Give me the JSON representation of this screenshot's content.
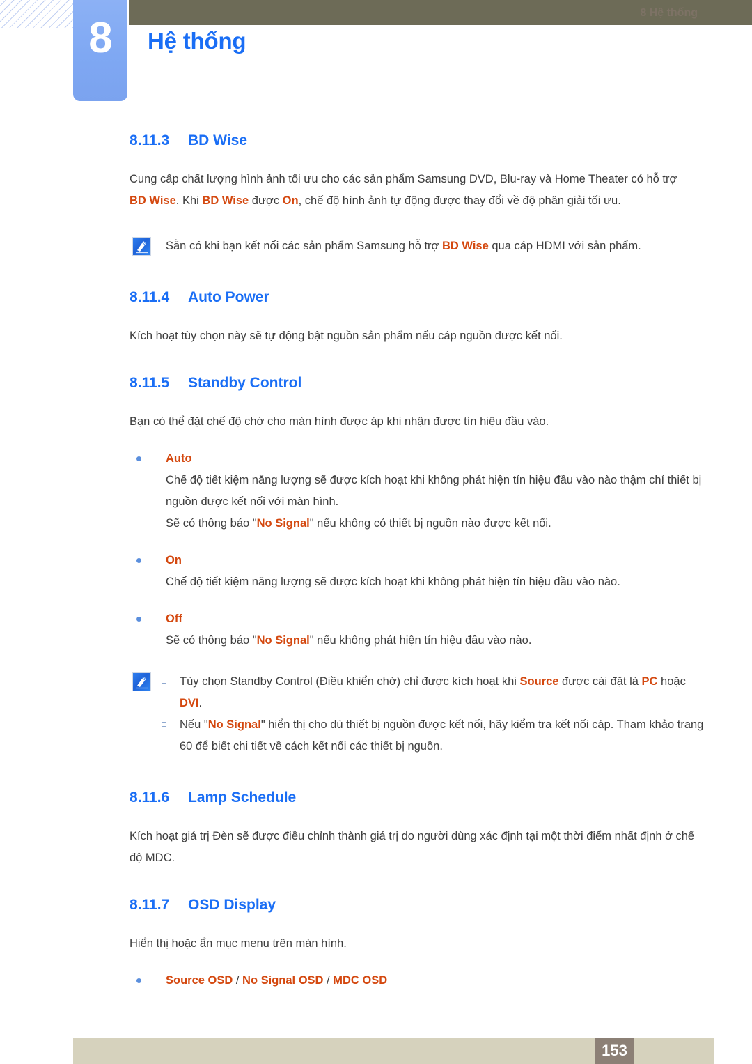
{
  "header": {
    "chapter_number": "8",
    "chapter_title": "Hệ thống"
  },
  "sections": [
    {
      "number": "8.11.3",
      "title": "BD Wise",
      "paragraph_pre": "Cung cấp chất lượng hình ảnh tối ưu cho các sản phẩm Samsung DVD, Blu-ray và Home Theater có hỗ trợ ",
      "kw1": "BD Wise",
      "paragraph_mid1": ". Khi ",
      "kw2": "BD Wise",
      "paragraph_mid2": " được ",
      "kw3": "On",
      "paragraph_end": ", chế độ hình ảnh tự động được thay đổi về độ phân giải tối ưu.",
      "note_pre": "Sẵn có khi bạn kết nối các sản phẩm Samsung hỗ trợ ",
      "note_kw": "BD Wise",
      "note_post": " qua cáp HDMI với sản phẩm."
    },
    {
      "number": "8.11.4",
      "title": "Auto Power",
      "paragraph": "Kích hoạt tùy chọn này sẽ tự động bật nguồn sản phẩm nếu cáp nguồn được kết nối."
    },
    {
      "number": "8.11.5",
      "title": "Standby Control",
      "paragraph": "Bạn có thể đặt chế độ chờ cho màn hình được áp khi nhận được tín hiệu đầu vào.",
      "items": [
        {
          "label": "Auto",
          "desc": "Chế độ tiết kiệm năng lượng sẽ được kích hoạt khi không phát hiện tín hiệu đầu vào nào thậm chí thiết bị nguồn được kết nối với màn hình.",
          "desc2_pre": "Sẽ có thông báo \"",
          "desc2_kw": "No Signal",
          "desc2_post": "\" nếu không có thiết bị nguồn nào được kết nối."
        },
        {
          "label": "On",
          "desc": "Chế độ tiết kiệm năng lượng sẽ được kích hoạt khi không phát hiện tín hiệu đầu vào nào."
        },
        {
          "label": "Off",
          "desc_pre": "Sẽ có thông báo \"",
          "desc_kw": "No Signal",
          "desc_post": "\" nếu không phát hiện tín hiệu đầu vào nào."
        }
      ],
      "notes": [
        {
          "pre": "Tùy chọn Standby Control (Điều khiển chờ) chỉ được kích hoạt khi ",
          "kw1": "Source",
          "mid": " được cài đặt là ",
          "kw2": "PC",
          "mid2": " hoặc ",
          "kw3": "DVI",
          "post": "."
        },
        {
          "pre": "Nếu \"",
          "kw1": "No Signal",
          "post": "\" hiển thị cho dù thiết bị nguồn được kết nối, hãy kiểm tra kết nối cáp. Tham khảo trang 60 để biết chi tiết về cách kết nối các thiết bị nguồn."
        }
      ]
    },
    {
      "number": "8.11.6",
      "title": "Lamp Schedule",
      "paragraph": "Kích hoạt giá trị Đèn sẽ được điều chỉnh thành giá trị do người dùng xác định tại một thời điểm nhất định ở chế độ MDC."
    },
    {
      "number": "8.11.7",
      "title": "OSD Display",
      "paragraph": "Hiển thị hoặc ẩn mục menu trên màn hình.",
      "option1": "Source OSD",
      "sep1": " / ",
      "option2": "No Signal OSD",
      "sep2": " / ",
      "option3": "MDC OSD"
    }
  ],
  "footer": {
    "label": "8 Hệ thống",
    "page": "153"
  },
  "colors": {
    "heading_blue": "#1a6ef5",
    "keyword_orange": "#d4480f",
    "olive_bar": "#6d6b57",
    "tab_blue": "#7fa8f3",
    "footer_bar": "#d6d2bd",
    "page_box": "#8c8076"
  }
}
